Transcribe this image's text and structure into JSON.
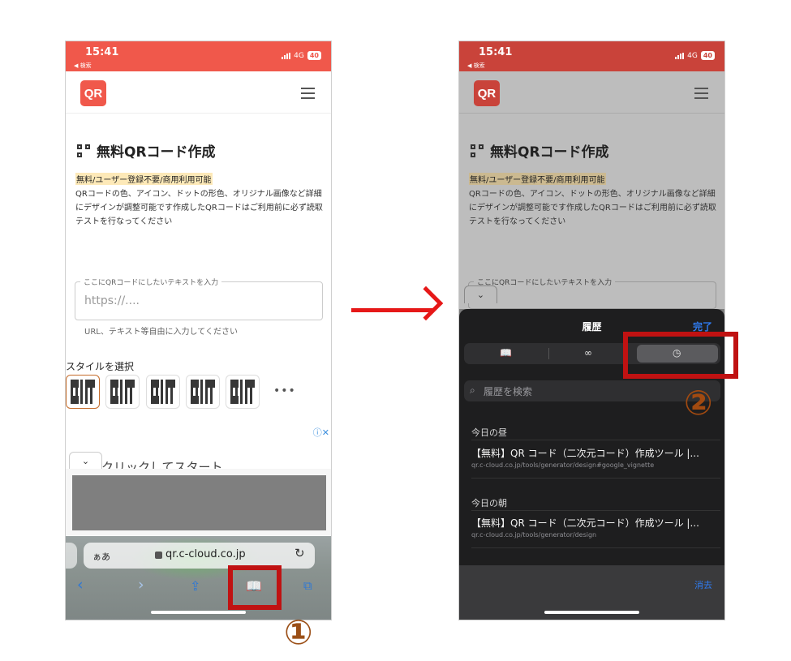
{
  "left": {
    "status": {
      "time": "15:41",
      "back": "◀ 検索",
      "network": "4G",
      "battery": "40"
    },
    "logo": "QR",
    "page_title": "無料QRコード作成",
    "highlight": "無料/ユーザー登録不要/商用利用可能",
    "description": "QRコードの色、アイコン、ドットの形色、オリジナル画像など詳細にデザインが調整可能です作成したQRコードはご利用前に必ず読取テストを行なってください",
    "input_label": "ここにQRコードにしたいテキストを入力",
    "input_placeholder": "https://....",
    "input_helper": "URL、テキスト等自由に入力してください",
    "style_label": "スタイルを選択",
    "more": "•••",
    "ad_text": "クリックしてスタート",
    "urlbar": {
      "aa": "ぁあ",
      "url": "qr.c-cloud.co.jp"
    }
  },
  "right": {
    "status": {
      "time": "15:41",
      "back": "◀ 検索",
      "network": "4G",
      "battery": "40"
    },
    "logo": "QR",
    "page_title": "無料QRコード作成",
    "highlight": "無料/ユーザー登録不要/商用利用可能",
    "description": "QRコードの色、アイコン、ドットの形色、オリジナル画像など詳細にデザインが調整可能です作成したQRコードはご利用前に必ず読取テストを行なってください",
    "input_label": "ここにQRコードにしたいテキストを入力",
    "sheet_title": "履歴",
    "done": "完了",
    "search_placeholder": "履歴を検索",
    "sections": [
      {
        "heading": "今日の昼",
        "title": "【無料】QR コード（二次元コード）作成ツール |...",
        "url": "qr.c-cloud.co.jp/tools/generator/design#google_vignette"
      },
      {
        "heading": "今日の朝",
        "title": "【無料】QR コード（二次元コード）作成ツール |...",
        "url": "qr.c-cloud.co.jp/tools/generator/design"
      }
    ],
    "clear": "消去"
  },
  "annotations": {
    "step1": "①",
    "step2": "②"
  },
  "colors": {
    "brand": "#f0584b",
    "highlight_box": "#c01212",
    "arrow": "#e61818",
    "ios_blue": "#2f7bf0"
  }
}
